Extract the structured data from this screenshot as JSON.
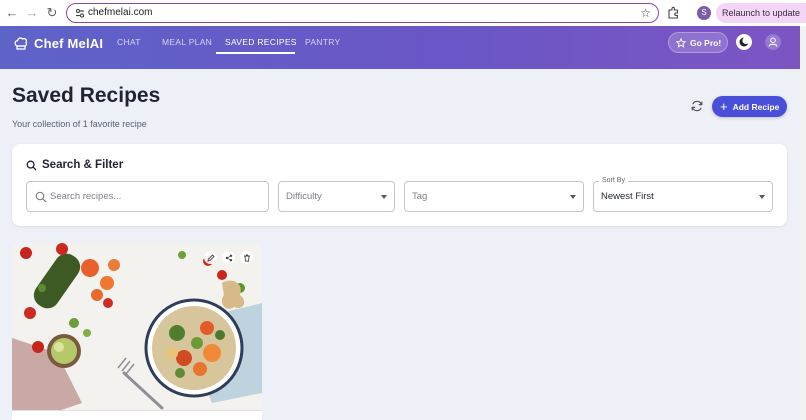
{
  "browser": {
    "url": "chefmelai.com",
    "profile_initial": "S",
    "relaunch_label": "Relaunch to update"
  },
  "app": {
    "logo_text": "Chef MelAI",
    "nav": [
      {
        "label": "CHAT",
        "active": false
      },
      {
        "label": "MEAL PLAN",
        "active": false
      },
      {
        "label": "SAVED RECIPES",
        "active": true
      },
      {
        "label": "PANTRY",
        "active": false
      }
    ],
    "gopro_label": "Go Pro!"
  },
  "page": {
    "title": "Saved Recipes",
    "subtitle": "Your collection of 1 favorite recipe",
    "add_recipe_label": "Add Recipe"
  },
  "filter": {
    "title": "Search & Filter",
    "search_placeholder": "Search recipes...",
    "difficulty_placeholder": "Difficulty",
    "tag_placeholder": "Tag",
    "sort_label": "Sort By",
    "sort_value": "Newest First"
  },
  "colors": {
    "header_start": "#5e63c8",
    "header_end": "#7c55c3",
    "accent": "#4a4fd9",
    "background": "#eef0f7"
  }
}
